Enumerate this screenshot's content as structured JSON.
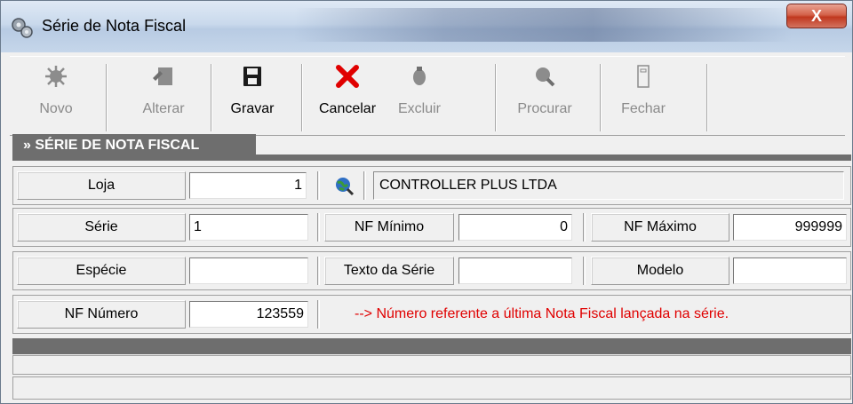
{
  "window": {
    "title": "Série de Nota Fiscal",
    "close_label": "X"
  },
  "toolbar": {
    "buttons": [
      {
        "label": "Novo",
        "icon": "new-icon",
        "enabled": false
      },
      {
        "label": "Alterar",
        "icon": "edit-icon",
        "enabled": false
      },
      {
        "label": "Gravar",
        "icon": "save-icon",
        "enabled": true
      },
      {
        "label": "Cancelar",
        "icon": "cancel-icon",
        "enabled": true
      },
      {
        "label": "Excluir",
        "icon": "delete-icon",
        "enabled": false
      },
      {
        "label": "Procurar",
        "icon": "search-icon",
        "enabled": false
      },
      {
        "label": "Fechar",
        "icon": "close-door-icon",
        "enabled": false
      }
    ]
  },
  "section": {
    "title": "» SÉRIE DE NOTA FISCAL"
  },
  "form": {
    "loja": {
      "label": "Loja",
      "value": "1",
      "store_name": "CONTROLLER PLUS LTDA"
    },
    "serie": {
      "label": "Série",
      "value": "1"
    },
    "nf_minimo": {
      "label": "NF Mínimo",
      "value": "0"
    },
    "nf_maximo": {
      "label": "NF Máximo",
      "value": "999999"
    },
    "especie": {
      "label": "Espécie",
      "value": ""
    },
    "texto_serie": {
      "label": "Texto da Série",
      "value": ""
    },
    "modelo": {
      "label": "Modelo",
      "value": ""
    },
    "nf_numero": {
      "label": "NF Número",
      "value": "123559"
    },
    "info": "--> Número referente a última Nota Fiscal lançada na série."
  },
  "colors": {
    "info_text": "#e00000",
    "section_bg": "#6e6e6e",
    "cancel_icon": "#e00000"
  }
}
